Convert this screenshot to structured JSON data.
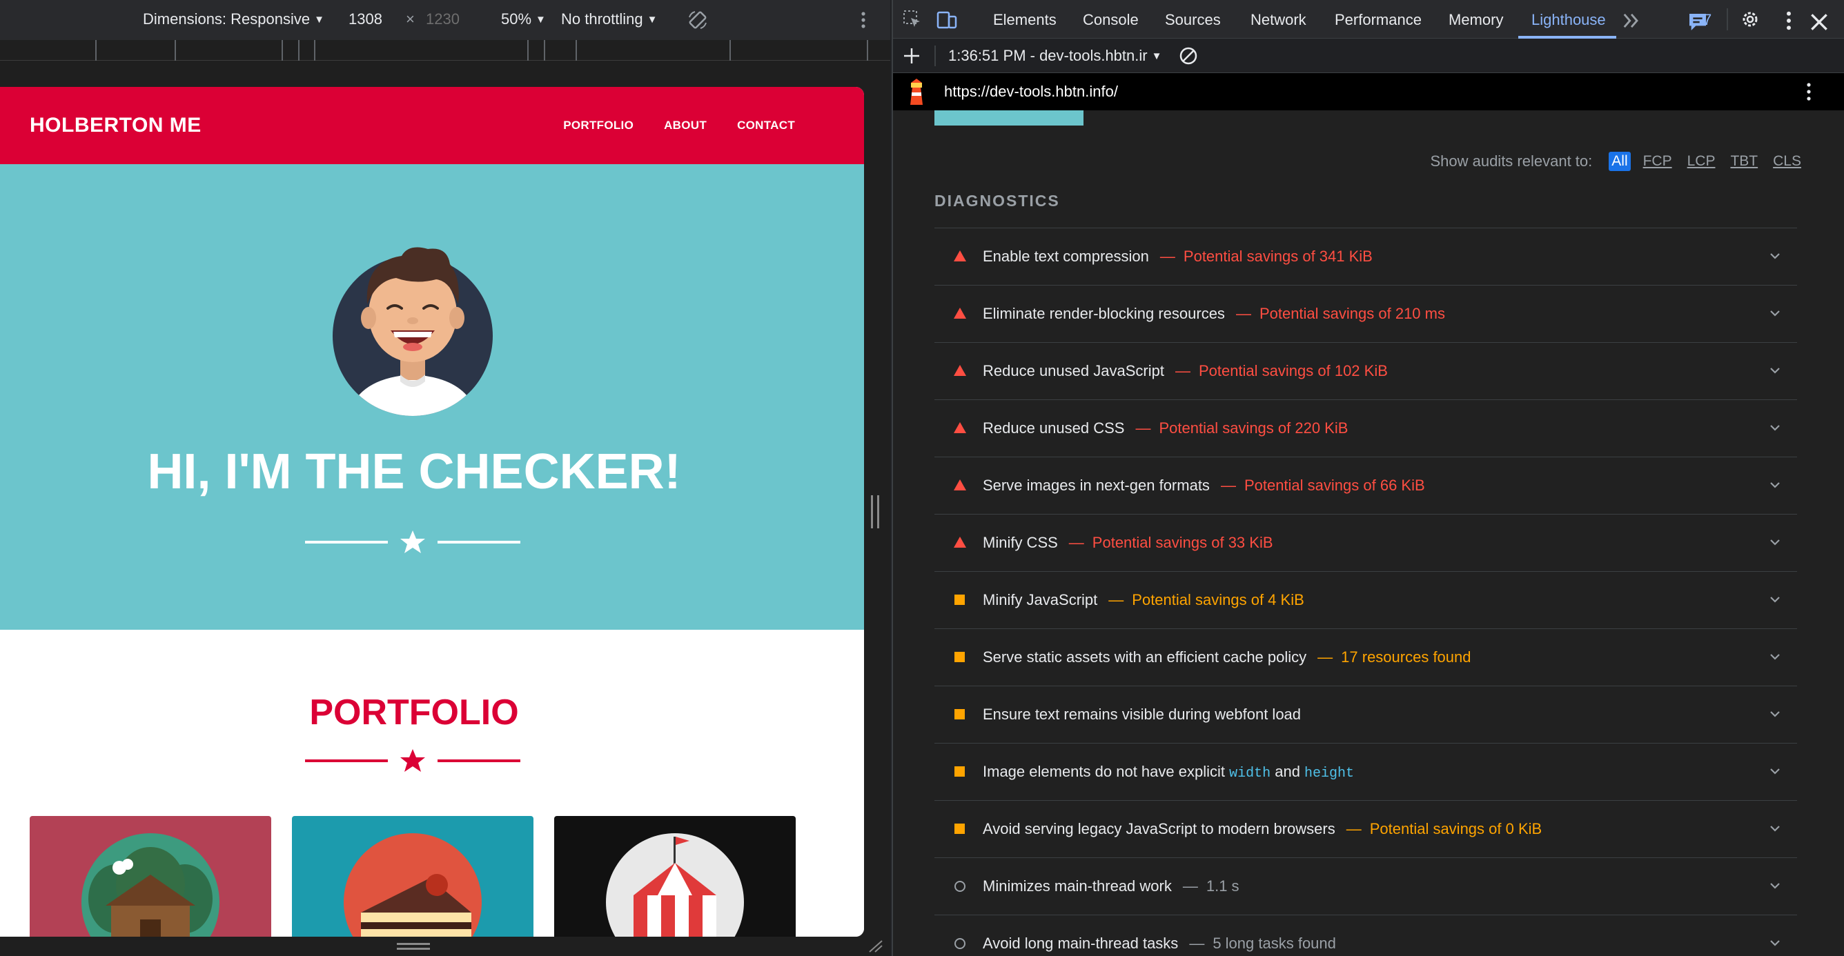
{
  "device_toolbar": {
    "dimensions_label": "Dimensions: Responsive",
    "width": "1308",
    "times": "×",
    "height_placeholder": "1230",
    "zoom": "50%",
    "throttling": "No throttling"
  },
  "site": {
    "logo": "HOLBERTON ME",
    "nav": [
      "PORTFOLIO",
      "ABOUT",
      "CONTACT"
    ],
    "hero_title": "HI, I'M THE CHECKER!",
    "portfolio_title": "PORTFOLIO",
    "colors": {
      "brand": "#db0035",
      "hero_bg": "#6cc5cc"
    }
  },
  "devtools": {
    "tabs": [
      "Elements",
      "Console",
      "Sources",
      "Network",
      "Performance",
      "Memory",
      "Lighthouse"
    ],
    "active_tab": "Lighthouse",
    "issues_count": "7",
    "report_selector": "1:36:51 PM - dev-tools.hbtn.ir",
    "url": "https://dev-tools.hbtn.info/",
    "filter_label": "Show audits relevant to:",
    "filters": [
      "All",
      "FCP",
      "LCP",
      "TBT",
      "CLS"
    ],
    "diagnostics_title": "DIAGNOSTICS",
    "audits": [
      {
        "status": "fail",
        "title": "Enable text compression",
        "detail": "Potential savings of 341 KiB"
      },
      {
        "status": "fail",
        "title": "Eliminate render-blocking resources",
        "detail": "Potential savings of 210 ms"
      },
      {
        "status": "fail",
        "title": "Reduce unused JavaScript",
        "detail": "Potential savings of 102 KiB"
      },
      {
        "status": "fail",
        "title": "Reduce unused CSS",
        "detail": "Potential savings of 220 KiB"
      },
      {
        "status": "fail",
        "title": "Serve images in next-gen formats",
        "detail": "Potential savings of 66 KiB"
      },
      {
        "status": "fail",
        "title": "Minify CSS",
        "detail": "Potential savings of 33 KiB"
      },
      {
        "status": "average",
        "title": "Minify JavaScript",
        "detail": "Potential savings of 4 KiB"
      },
      {
        "status": "average",
        "title": "Serve static assets with an efficient cache policy",
        "detail": "17 resources found"
      },
      {
        "status": "average",
        "title": "Ensure text remains visible during webfont load",
        "detail": ""
      },
      {
        "status": "average",
        "title_parts": [
          "Image elements do not have explicit ",
          "width",
          " and ",
          "height"
        ],
        "detail": ""
      },
      {
        "status": "average",
        "title": "Avoid serving legacy JavaScript to modern browsers",
        "detail": "Potential savings of 0 KiB"
      },
      {
        "status": "pass",
        "title": "Minimizes main-thread work",
        "detail": "1.1 s"
      },
      {
        "status": "pass",
        "title": "Avoid long main-thread tasks",
        "detail": "5 long tasks found"
      }
    ],
    "separator": "—"
  }
}
